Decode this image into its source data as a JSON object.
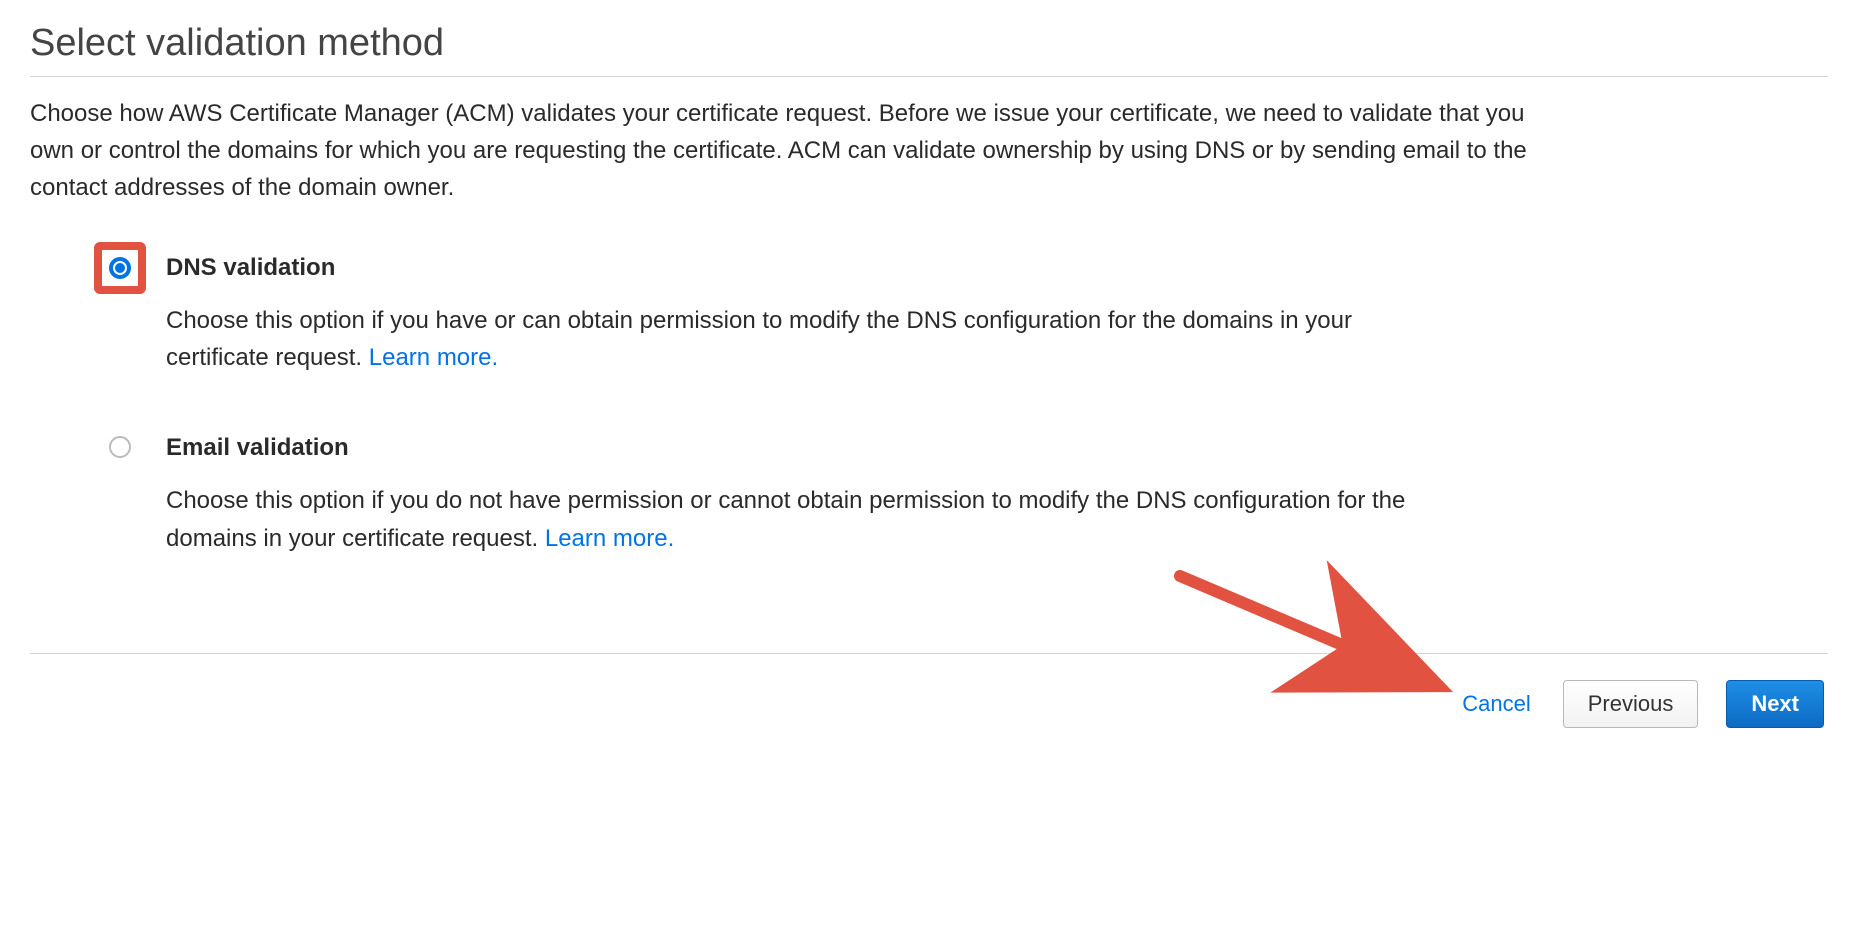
{
  "title": "Select validation method",
  "intro": "Choose how AWS Certificate Manager (ACM) validates your certificate request. Before we issue your certificate, we need to validate that you own or control the domains for which you are requesting the certificate. ACM can validate ownership by using DNS or by sending email to the contact addresses of the domain owner.",
  "options": {
    "dns": {
      "title": "DNS validation",
      "desc": "Choose this option if you have or can obtain permission to modify the DNS configuration for the domains in your certificate request. ",
      "learn_more": "Learn more.",
      "selected": true
    },
    "email": {
      "title": "Email validation",
      "desc": "Choose this option if you do not have permission or cannot obtain permission to modify the DNS configuration for the domains in your certificate request. ",
      "learn_more": "Learn more.",
      "selected": false
    }
  },
  "footer": {
    "cancel": "Cancel",
    "previous": "Previous",
    "next": "Next"
  },
  "annotation": {
    "highlight_color": "#e15241",
    "arrow_color": "#e15241"
  }
}
